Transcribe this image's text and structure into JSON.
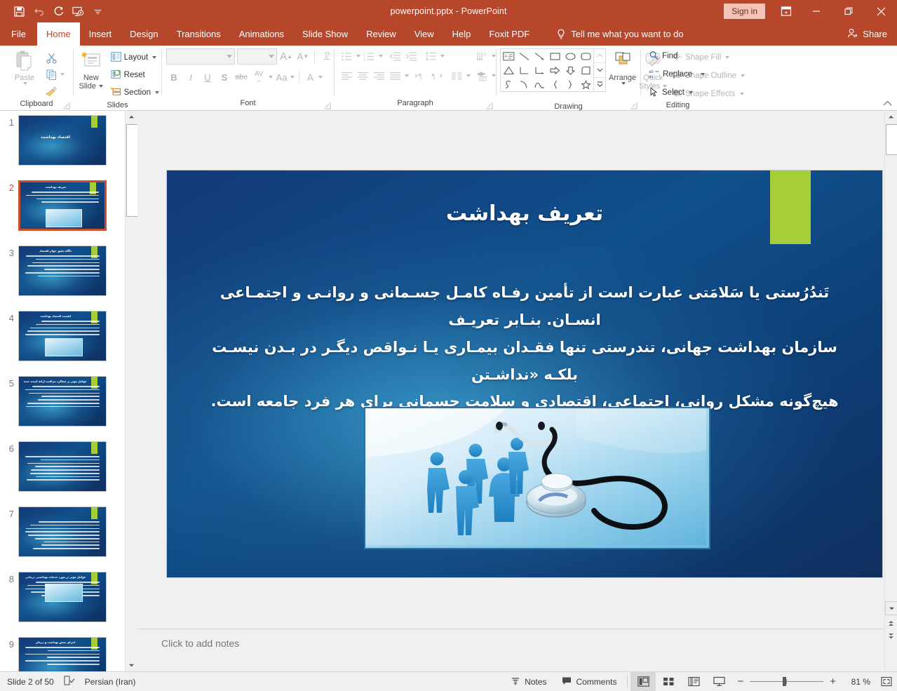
{
  "titlebar": {
    "document_title": "powerpoint.pptx  -  PowerPoint",
    "signin_label": "Sign in",
    "qat": [
      {
        "name": "save-icon",
        "label": "Save"
      },
      {
        "name": "undo-icon",
        "label": "Undo"
      },
      {
        "name": "redo-icon",
        "label": "Redo"
      },
      {
        "name": "start-from-beginning-icon",
        "label": "Start From Beginning"
      },
      {
        "name": "customize-quick-access-toolbar-icon",
        "label": "Customize Quick Access Toolbar"
      }
    ],
    "ribbon_display_options": "Ribbon Display Options",
    "minimize": "Minimize",
    "restore": "Restore Down",
    "close": "Close"
  },
  "tabs": [
    {
      "label": "File",
      "active": false
    },
    {
      "label": "Home",
      "active": true
    },
    {
      "label": "Insert",
      "active": false
    },
    {
      "label": "Design",
      "active": false
    },
    {
      "label": "Transitions",
      "active": false
    },
    {
      "label": "Animations",
      "active": false
    },
    {
      "label": "Slide Show",
      "active": false
    },
    {
      "label": "Review",
      "active": false
    },
    {
      "label": "View",
      "active": false
    },
    {
      "label": "Help",
      "active": false
    },
    {
      "label": "Foxit PDF",
      "active": false
    }
  ],
  "tellme": {
    "placeholder": "Tell me what you want to do"
  },
  "share": {
    "label": "Share"
  },
  "ribbon": {
    "groups": [
      {
        "id": "clipboard",
        "label": "Clipboard"
      },
      {
        "id": "slides",
        "label": "Slides"
      },
      {
        "id": "font",
        "label": "Font"
      },
      {
        "id": "paragraph",
        "label": "Paragraph"
      },
      {
        "id": "drawing",
        "label": "Drawing"
      },
      {
        "id": "editing",
        "label": "Editing"
      }
    ],
    "clipboard": {
      "paste_label": "Paste",
      "cut_label": "Cut",
      "copy_label": "Copy",
      "format_painter_label": "Format Painter"
    },
    "slides": {
      "new_slide_line1": "New",
      "new_slide_line2": "Slide",
      "layout_label": "Layout",
      "reset_label": "Reset",
      "section_label": "Section"
    },
    "font": {
      "font_name_value": "",
      "font_size_value": "",
      "increase_font_size": "A",
      "decrease_font_size": "A",
      "clear_formatting": "Clear All Formatting",
      "bold": "B",
      "italic": "I",
      "underline": "U",
      "shadow": "S",
      "strikethrough": "abc",
      "character_spacing": "AV",
      "change_case": "Aa",
      "font_color": "A"
    },
    "paragraph": {
      "bullets": "Bullets",
      "numbering": "Numbering",
      "decrease_indent": "Decrease List Level",
      "increase_indent": "Increase List Level",
      "line_spacing": "Line Spacing",
      "align_left": "Align Left",
      "center": "Center",
      "align_right": "Align Right",
      "justify": "Justify",
      "ltr": "Left-to-Right Text Direction",
      "rtl": "Right-to-Left Text Direction",
      "columns": "Add or Remove Columns",
      "text_direction": "Text Direction",
      "align_text": "Align Text",
      "convert_smartart": "Convert to SmartArt"
    },
    "drawing": {
      "arrange_label": "Arrange",
      "quick_styles_line1": "Quick",
      "quick_styles_line2": "Styles",
      "shape_fill": "Shape Fill",
      "shape_outline": "Shape Outline",
      "shape_effects": "Shape Effects"
    },
    "editing": {
      "find": "Find",
      "replace": "Replace",
      "select": "Select"
    },
    "collapse": "Collapse the Ribbon"
  },
  "thumbnails": {
    "selected": 2,
    "slides": [
      {
        "num": "1",
        "kind": "title",
        "title": "اقتصاد بهداشت",
        "lines": 0,
        "photo": false
      },
      {
        "num": "2",
        "kind": "content",
        "title": "تعریف بهداشت",
        "lines": 4,
        "photo": true
      },
      {
        "num": "3",
        "kind": "content",
        "title": "ناگاه دقیق جهان اقتصاد",
        "lines": 7,
        "photo": false
      },
      {
        "num": "4",
        "kind": "content",
        "title": "اهمیت اقتصاد بهداشت",
        "lines": 5,
        "photo": true
      },
      {
        "num": "5",
        "kind": "content",
        "title": "عوامل موثر بر عملکرد مراقبت ارائه کننده خدمات درمانی",
        "lines": 7,
        "photo": false
      },
      {
        "num": "6",
        "kind": "content",
        "title": "",
        "lines": 8,
        "photo": false
      },
      {
        "num": "7",
        "kind": "content",
        "title": "",
        "lines": 9,
        "photo": false
      },
      {
        "num": "8",
        "kind": "content",
        "title": "عوامل موثر در مورد خدمات بهداشتی درمانی",
        "lines": 5,
        "photo": true
      },
      {
        "num": "9",
        "kind": "content",
        "title": "اجزای بخش بهداشت و درمان",
        "lines": 6,
        "photo": false
      }
    ]
  },
  "slide": {
    "title": "تعریف بهداشت",
    "body_lines": [
      "تَندُرُستی یا سَلامَتی عبارت است از تأمین رفـاه کامـل جسـمانی و روانـی و اجتمـاعی انسـان. بنـابر تعریـف",
      "سازمان بهداشت جهانی، تندرستی تنها فقـدان بیمـاری یـا نـواقص دیگـر در بـدن نیسـت بلکـه «نداشـتن",
      "هیچ‌گونه مشکل روانی، اجتماعی، اقتصادی و سلامت جسمانی برای هر فرد جامعه است."
    ],
    "photo_alt": "blue human figures and a stethoscope",
    "accent_color": "#a6ce39",
    "background_color": "#10508c"
  },
  "notes": {
    "placeholder": "Click to add notes"
  },
  "status": {
    "slide_counter": "Slide 2 of 50",
    "accessibility_icon": "accessibility-checker-icon",
    "language": "Persian (Iran)",
    "notes_label": "Notes",
    "comments_label": "Comments",
    "views": [
      {
        "name": "normal-view",
        "active": true
      },
      {
        "name": "slide-sorter-view",
        "active": false
      },
      {
        "name": "reading-view",
        "active": false
      },
      {
        "name": "slide-show-view",
        "active": false
      }
    ],
    "zoom_out": "−",
    "zoom_in": "+",
    "zoom_value": "81 %",
    "fit_to_window": "Fit slide to current window"
  }
}
